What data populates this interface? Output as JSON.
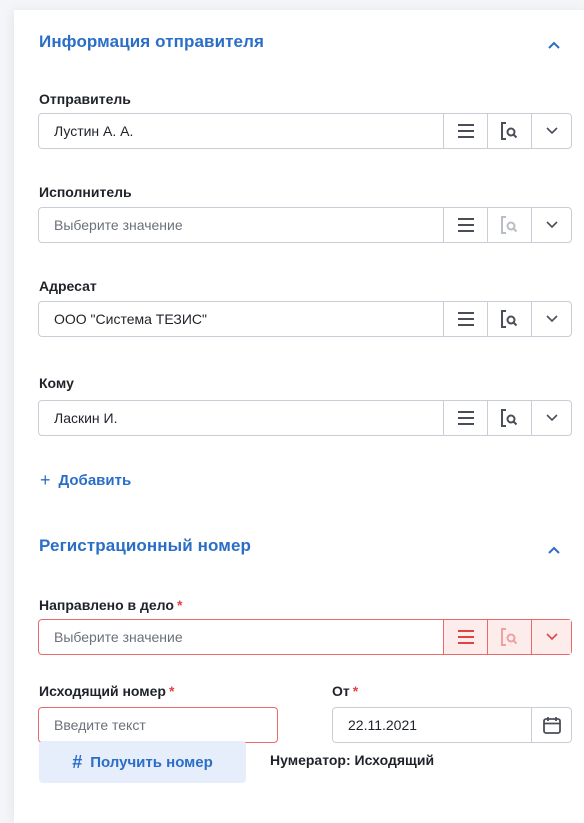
{
  "sender_section": {
    "title": "Информация отправителя",
    "sender": {
      "label": "Отправитель",
      "value": "Лустин А. А."
    },
    "executor": {
      "label": "Исполнитель",
      "placeholder": "Выберите значение"
    },
    "addressee": {
      "label": "Адресат",
      "value": "ООО \"Система ТЕЗИС\""
    },
    "to": {
      "label": "Кому",
      "value": "Ласкин И."
    },
    "add_label": "Добавить",
    "add_icon": "+"
  },
  "reg_section": {
    "title": "Регистрационный номер",
    "case": {
      "label": "Направлено в дело",
      "required": "*",
      "placeholder": "Выберите значение"
    },
    "outgoing": {
      "label": "Исходящий номер",
      "required": "*",
      "placeholder": "Введите текст"
    },
    "date": {
      "label": "От",
      "required": "*",
      "value": "22.11.2021"
    },
    "get_number_label": "Получить номер",
    "get_number_icon": "#",
    "numerator_label": "Нумератор: Исходящий"
  },
  "colors": {
    "accent": "#2a6ec7",
    "error": "#e86a6a",
    "required": "#e04343",
    "disabled_icon": "#b9bec6"
  },
  "icons": {
    "collapse": "chevron-up-icon",
    "list": "list-icon",
    "lookup": "search-document-icon",
    "dropdown": "chevron-down-icon",
    "calendar": "calendar-icon"
  }
}
